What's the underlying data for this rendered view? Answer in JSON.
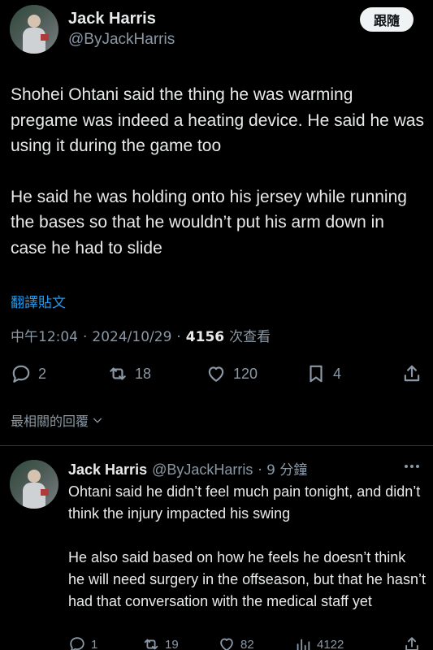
{
  "tweet": {
    "author_name": "Jack Harris",
    "author_handle": "@ByJackHarris",
    "follow_label": "跟隨",
    "paragraphs": [
      "Shohei Ohtani said the thing he was warming pregame was indeed a heating device. He said he was using it during the game too",
      "He said he was holding onto his jersey while running the bases so that he wouldn’t put his arm down in case he had to slide"
    ],
    "translate_label": "翻譯貼文",
    "time": "中午12:04",
    "date": "2024/10/29",
    "separator": "·",
    "views": "4156",
    "views_label": "次查看",
    "actions": {
      "replies": "2",
      "reposts": "18",
      "likes": "120",
      "bookmarks": "4"
    }
  },
  "sort_label": "最相關的回覆",
  "reply": {
    "author_name": "Jack Harris",
    "author_handle": "@ByJackHarris",
    "time": "· 9 分鐘",
    "paragraphs": [
      "Ohtani said he didn’t feel much pain tonight, and didn’t think the injury impacted his swing",
      "He also said based on how he feels he doesn’t think he will need surgery in the offseason, but that he hasn’t had that conversation with the medical staff yet"
    ],
    "actions": {
      "replies": "1",
      "reposts": "19",
      "likes": "82",
      "views": "4122"
    }
  },
  "colors": {
    "background": "#000000",
    "text": "#e7e9ea",
    "secondary": "#8b98a5",
    "link": "#1d9bf0",
    "divider": "#2f3336"
  }
}
